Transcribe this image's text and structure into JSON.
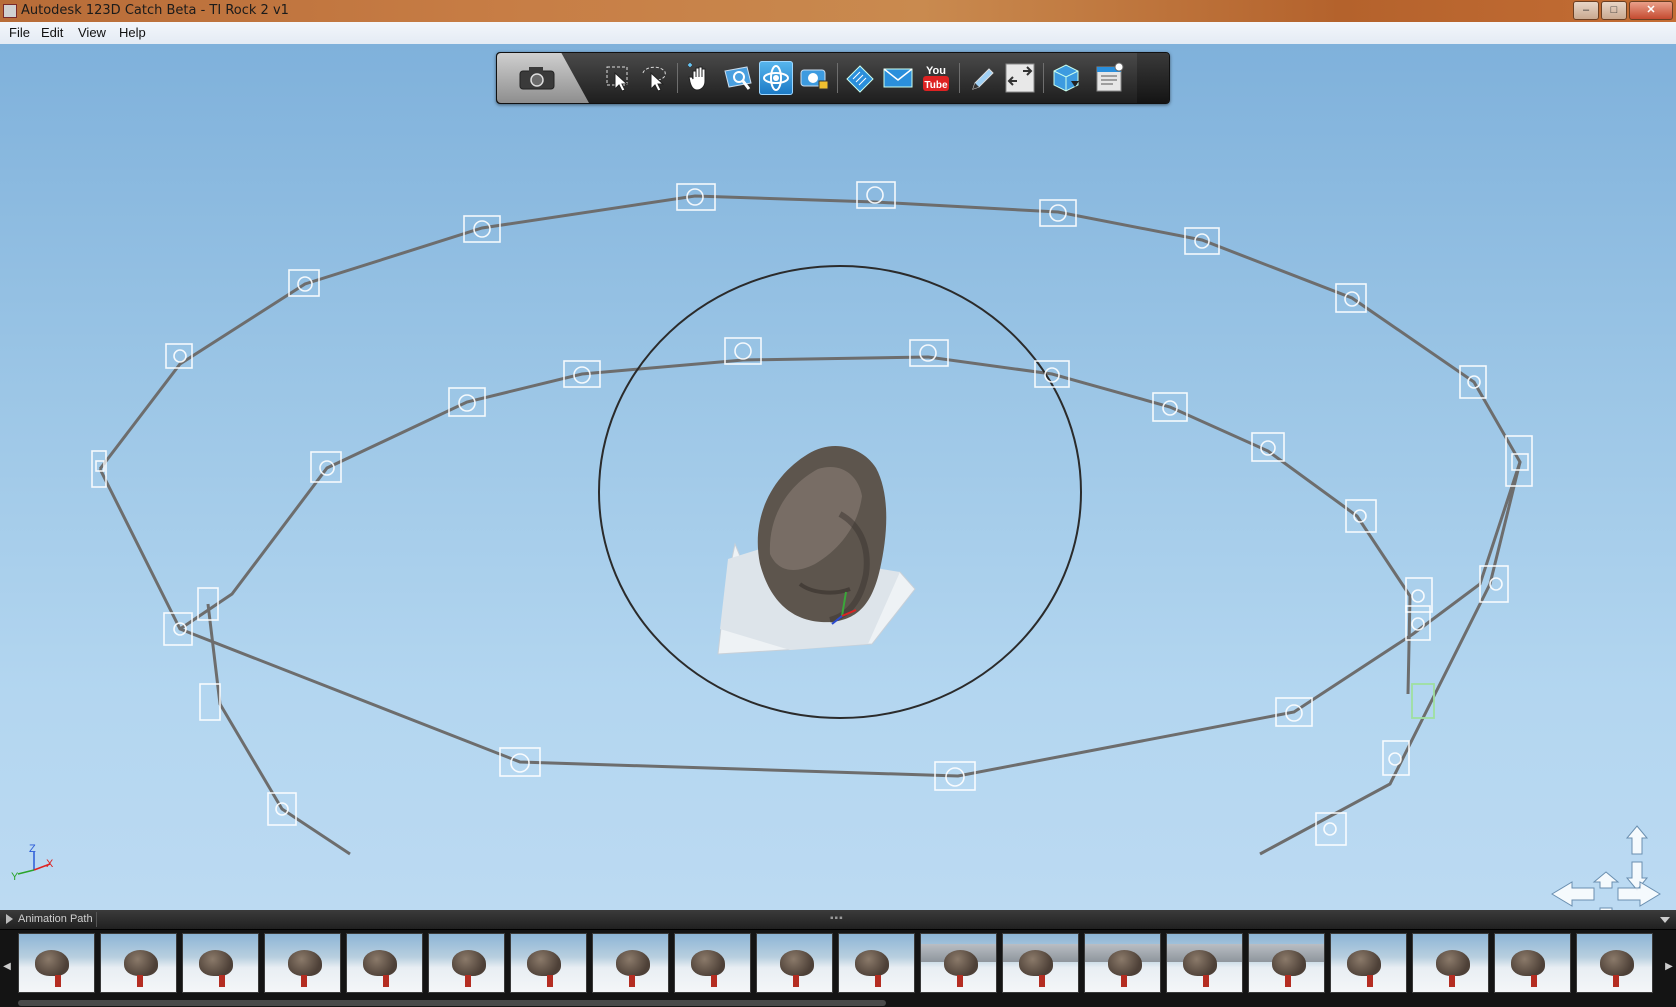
{
  "window": {
    "title": "Autodesk 123D Catch Beta - TI Rock 2 v1",
    "controls": {
      "minimize": "–",
      "maximize": "□",
      "close": "✕"
    }
  },
  "menu": {
    "items": [
      "File",
      "Edit",
      "View",
      "Help"
    ]
  },
  "toolbar": {
    "camera_mode": "camera-icon",
    "buttons": [
      {
        "name": "select-icon",
        "active": false
      },
      {
        "name": "lasso-select-icon",
        "active": false
      },
      {
        "name": "pan-icon",
        "active": false
      },
      {
        "name": "zoom-icon",
        "active": false
      },
      {
        "name": "orbit-icon",
        "active": true
      },
      {
        "name": "camera-lock-icon",
        "active": false
      },
      {
        "name": "ruler-icon",
        "active": false
      },
      {
        "name": "email-icon",
        "active": false
      },
      {
        "name": "youtube-icon",
        "active": false
      },
      {
        "name": "pen-icon",
        "active": false
      },
      {
        "name": "export-icon",
        "active": false
      },
      {
        "name": "mesh-download-icon",
        "active": false
      },
      {
        "name": "properties-icon",
        "active": false
      }
    ],
    "youtube_label": "You\nTube"
  },
  "axes": {
    "x": "X",
    "y": "Y",
    "z": "Z"
  },
  "colors": {
    "selected_camera": "#9fe0a0",
    "orbit_active": "#2a8fdc"
  },
  "filmstrip": {
    "label": "Animation Path",
    "grip": "▪▪▪",
    "thumbnail_count": 20
  }
}
